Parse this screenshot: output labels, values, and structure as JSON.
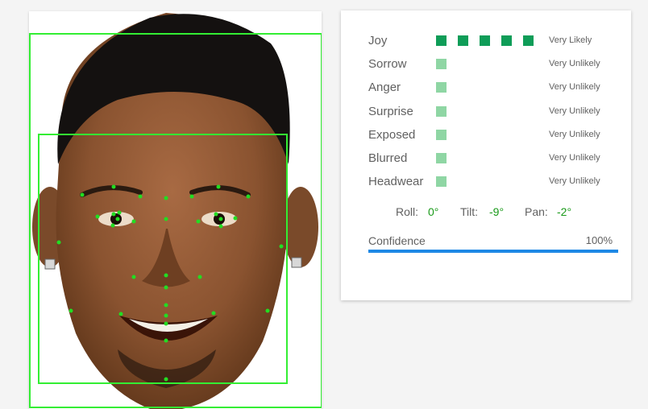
{
  "detections": [
    {
      "label": "Joy",
      "likelihood": "Very Likely",
      "level": 5
    },
    {
      "label": "Sorrow",
      "likelihood": "Very Unlikely",
      "level": 1
    },
    {
      "label": "Anger",
      "likelihood": "Very Unlikely",
      "level": 1
    },
    {
      "label": "Surprise",
      "likelihood": "Very Unlikely",
      "level": 1
    },
    {
      "label": "Exposed",
      "likelihood": "Very Unlikely",
      "level": 1
    },
    {
      "label": "Blurred",
      "likelihood": "Very Unlikely",
      "level": 1
    },
    {
      "label": "Headwear",
      "likelihood": "Very Unlikely",
      "level": 1
    }
  ],
  "angles": {
    "roll_label": "Roll:",
    "roll_value": "0°",
    "tilt_label": "Tilt:",
    "tilt_value": "-9°",
    "pan_label": "Pan:",
    "pan_value": "-2°"
  },
  "confidence": {
    "label": "Confidence",
    "value": "100%",
    "fraction": 1.0
  },
  "colors": {
    "likely_bar": "#0f9d58",
    "unlikely_bar": "#8fd6a4",
    "landmark": "#22dd22",
    "box": "#33ee33",
    "confidence_bar": "#1e88e5",
    "angle_value": "#1a9a1a"
  }
}
